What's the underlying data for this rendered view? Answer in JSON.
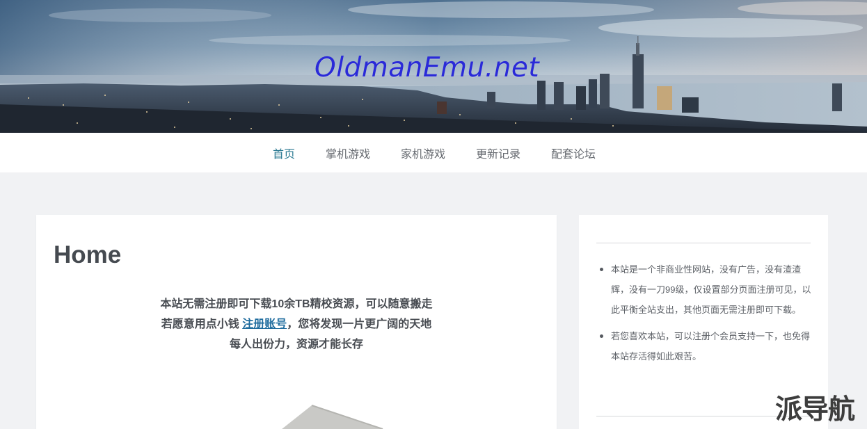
{
  "header": {
    "site_title": "OldmanEmu.net"
  },
  "nav": {
    "items": [
      {
        "label": "首页",
        "active": true
      },
      {
        "label": "掌机游戏",
        "active": false
      },
      {
        "label": "家机游戏",
        "active": false
      },
      {
        "label": "更新记录",
        "active": false
      },
      {
        "label": "配套论坛",
        "active": false
      }
    ]
  },
  "main": {
    "title": "Home",
    "intro_line1": "本站无需注册即可下载10余TB精校资源，可以随意搬走",
    "intro_line2_before": "若愿意用点小钱 ",
    "intro_link": "注册账号",
    "intro_line2_after": "，您将发现一片更广阔的天地",
    "intro_line3": "每人出份力，资源才能长存"
  },
  "sidebar": {
    "items": [
      "本站是一个非商业性网站，没有广告，没有渣渣辉，没有一刀99级，仅设置部分页面注册可见，以此平衡全站支出，其他页面无需注册即可下载。",
      "若您喜欢本站，可以注册个会员支持一下，也免得本站存活得如此艰苦。"
    ]
  },
  "watermark": {
    "text": "派导航"
  },
  "colors": {
    "nav_active": "#2b7a92",
    "link": "#1f6c9e",
    "title_blue": "#2a2ad8",
    "page_bg": "#f1f2f4"
  }
}
